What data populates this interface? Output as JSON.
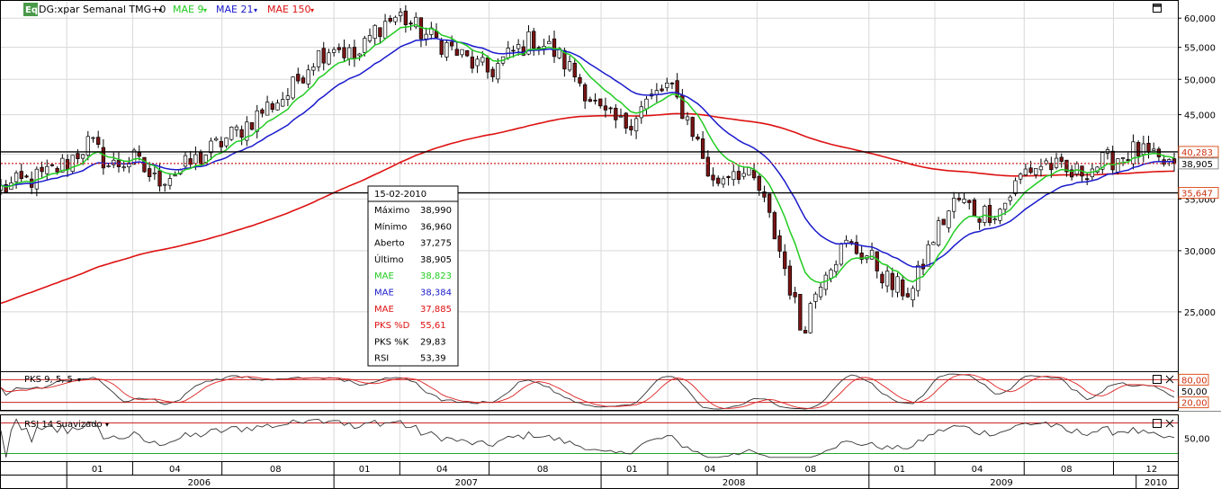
{
  "header": {
    "badge": "Eq",
    "symbol": "DG:xpar Semanal TMG+0",
    "indicators": [
      {
        "label": "MAE 9",
        "color": "#22cc22"
      },
      {
        "label": "MAE 21",
        "color": "#1a1acc"
      },
      {
        "label": "MAE 150",
        "color": "#dd1111"
      }
    ]
  },
  "colors": {
    "up": "#ffffff",
    "down": "#7a1414",
    "pks_d": "#dd2222",
    "pks_k": "#333333",
    "rsi": "#333333",
    "levels": "#000000",
    "grid": "#d8d8d8"
  },
  "tooltip": {
    "date": "15-02-2010",
    "rows": [
      {
        "label": "Máximo",
        "value": "38,990",
        "color": "#000000"
      },
      {
        "label": "Mínimo",
        "value": "36,960",
        "color": "#000000"
      },
      {
        "label": "Aberto",
        "value": "37,275",
        "color": "#000000"
      },
      {
        "label": "Último",
        "value": "38,905",
        "color": "#000000"
      },
      {
        "label": "MAE",
        "value": "38,823",
        "color": "#22cc22"
      },
      {
        "label": "MAE",
        "value": "38,384",
        "color": "#1a1acc"
      },
      {
        "label": "MAE",
        "value": "37,885",
        "color": "#dd1111"
      },
      {
        "label": "PKS %D",
        "value": "55,61",
        "color": "#dd1111"
      },
      {
        "label": "PKS %K",
        "value": "29,83",
        "color": "#000000"
      },
      {
        "label": "RSI",
        "value": "53,39",
        "color": "#000000"
      }
    ]
  },
  "subpanels": {
    "pks_title": "PKS 9, 5, 5",
    "rsi_title": "RSI 14 Suavizado"
  },
  "chart_data": {
    "type": "candlestick",
    "price_axis": {
      "ticks": [
        25000,
        30000,
        35000,
        40000,
        45000,
        50000,
        55000,
        60000
      ],
      "tick_labels": [
        "25,000",
        "30,000",
        "35,000",
        "40,000",
        "45,000",
        "50,000",
        "55,000",
        "60,000"
      ],
      "scale": "log",
      "range": [
        21000,
        63000
      ]
    },
    "horizontal_levels": [
      {
        "value": 40283,
        "label": "40,283",
        "style": "solid"
      },
      {
        "value": 38905,
        "label": "38,905",
        "style": "dotted"
      },
      {
        "value": 35647,
        "label": "35,647",
        "style": "solid"
      }
    ],
    "month_labels": [
      {
        "label": "01",
        "date": "2006-01"
      },
      {
        "label": "04",
        "date": "2006-04"
      },
      {
        "label": "08",
        "date": "2006-08"
      },
      {
        "label": "01",
        "date": "2007-01"
      },
      {
        "label": "04",
        "date": "2007-04"
      },
      {
        "label": "08",
        "date": "2007-08"
      },
      {
        "label": "01",
        "date": "2008-01"
      },
      {
        "label": "04",
        "date": "2008-04"
      },
      {
        "label": "08",
        "date": "2008-08"
      },
      {
        "label": "01",
        "date": "2009-01"
      },
      {
        "label": "04",
        "date": "2009-04"
      },
      {
        "label": "08",
        "date": "2009-08"
      },
      {
        "label": "12",
        "date": "2009-12"
      }
    ],
    "year_labels": [
      "2006",
      "2007",
      "2008",
      "2009",
      "2010"
    ],
    "price_path": [
      [
        "2005-10",
        36000
      ],
      [
        "2005-12",
        37500
      ],
      [
        "2006-01",
        39000
      ],
      [
        "2006-02",
        41500
      ],
      [
        "2006-03",
        38500
      ],
      [
        "2006-04",
        39500
      ],
      [
        "2006-05",
        37000
      ],
      [
        "2006-06",
        38000
      ],
      [
        "2006-07",
        39500
      ],
      [
        "2006-08",
        41500
      ],
      [
        "2006-09",
        43500
      ],
      [
        "2006-10",
        46000
      ],
      [
        "2006-11",
        48000
      ],
      [
        "2006-12",
        53000
      ],
      [
        "2007-01",
        55500
      ],
      [
        "2007-02",
        53000
      ],
      [
        "2007-03",
        58500
      ],
      [
        "2007-04",
        60500
      ],
      [
        "2007-05",
        57500
      ],
      [
        "2007-06",
        55500
      ],
      [
        "2007-07",
        53000
      ],
      [
        "2007-08",
        51000
      ],
      [
        "2007-09",
        54000
      ],
      [
        "2007-10",
        56500
      ],
      [
        "2007-11",
        54000
      ],
      [
        "2007-12",
        50000
      ],
      [
        "2008-01",
        45000
      ],
      [
        "2008-02",
        43500
      ],
      [
        "2008-03",
        46500
      ],
      [
        "2008-04",
        49000
      ],
      [
        "2008-05",
        44000
      ],
      [
        "2008-06",
        36500
      ],
      [
        "2008-07",
        38500
      ],
      [
        "2008-08",
        36500
      ],
      [
        "2008-09",
        30000
      ],
      [
        "2008-10",
        23500
      ],
      [
        "2008-11",
        28500
      ],
      [
        "2008-12",
        30500
      ],
      [
        "2009-01",
        29500
      ],
      [
        "2009-02",
        27000
      ],
      [
        "2009-03",
        26500
      ],
      [
        "2009-04",
        31500
      ],
      [
        "2009-05",
        35000
      ],
      [
        "2009-06",
        33500
      ],
      [
        "2009-07",
        34000
      ],
      [
        "2009-08",
        38000
      ],
      [
        "2009-09",
        39000
      ],
      [
        "2009-10",
        37500
      ],
      [
        "2009-11",
        38500
      ],
      [
        "2009-12",
        39500
      ],
      [
        "2010-01",
        40500
      ],
      [
        "2010-02",
        38905
      ]
    ],
    "moving_averages": [
      {
        "name": "MAE 9",
        "period": 9,
        "color": "#22cc22"
      },
      {
        "name": "MAE 21",
        "period": 21,
        "color": "#1a1acc"
      },
      {
        "name": "MAE 150",
        "period": 150,
        "color": "#dd1111"
      }
    ],
    "pks_axis": {
      "ticks": [
        20,
        50,
        80
      ],
      "tick_labels": [
        "20,00",
        "50,00",
        "80,00"
      ],
      "range": [
        0,
        100
      ]
    },
    "rsi_axis": {
      "ticks": [
        50
      ],
      "tick_labels": [
        "50,00"
      ],
      "range": [
        20,
        80
      ]
    },
    "rsi_levels": [
      70,
      30
    ]
  }
}
